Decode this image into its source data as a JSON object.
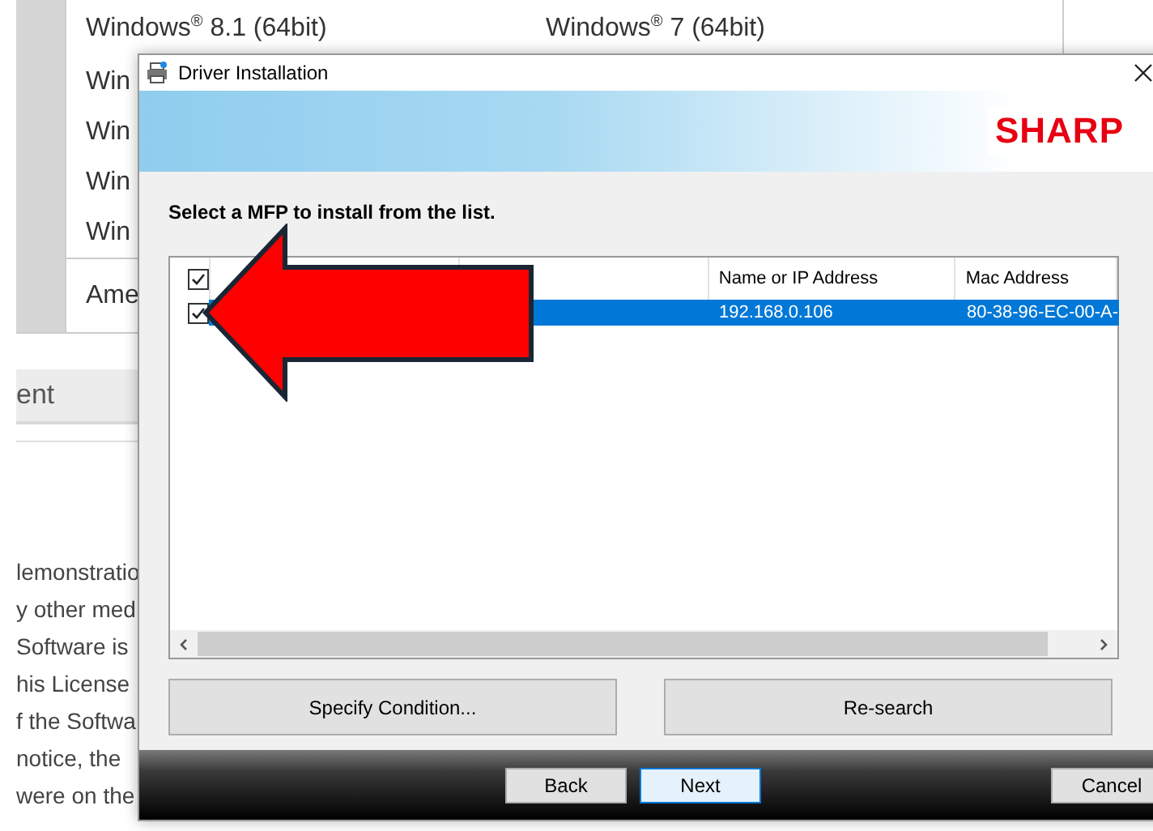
{
  "background_page": {
    "table_rows": [
      {
        "cells": [
          "Windows$^{®}$ 8.1 (64bit)",
          "Windows$^{®}$ 7 (64bit)"
        ]
      },
      {
        "cells": [
          "Win"
        ]
      },
      {
        "cells": [
          "Win"
        ]
      },
      {
        "cells": [
          "Win"
        ]
      },
      {
        "cells": [
          "Win"
        ]
      },
      {
        "cells": [
          "Ame"
        ]
      }
    ],
    "tab_label": "ent",
    "text_lines": [
      "lemonstratio",
      "y other med",
      "Software is",
      "his License",
      "f the Softwa",
      "notice, the",
      "were on the"
    ]
  },
  "dialog": {
    "title": "Driver Installation",
    "logo": "SHARP",
    "instruction": "Select a MFP to install from the list.",
    "list": {
      "header_checked": true,
      "columns": [
        "Name or IP Address",
        "Mac Address"
      ],
      "rows": [
        {
          "checked": true,
          "selected": true,
          "cells": [
            "192.168.0.106",
            "80-38-96-EC-00-A-"
          ]
        }
      ]
    },
    "buttons": [
      "Specify Condition...",
      "Re-search"
    ],
    "footer_buttons": [
      {
        "label": "Back",
        "focused": false,
        "kind": "left"
      },
      {
        "label": "Next",
        "focused": true,
        "kind": "left"
      },
      {
        "label": "Cancel",
        "focused": false,
        "kind": "right"
      }
    ]
  }
}
